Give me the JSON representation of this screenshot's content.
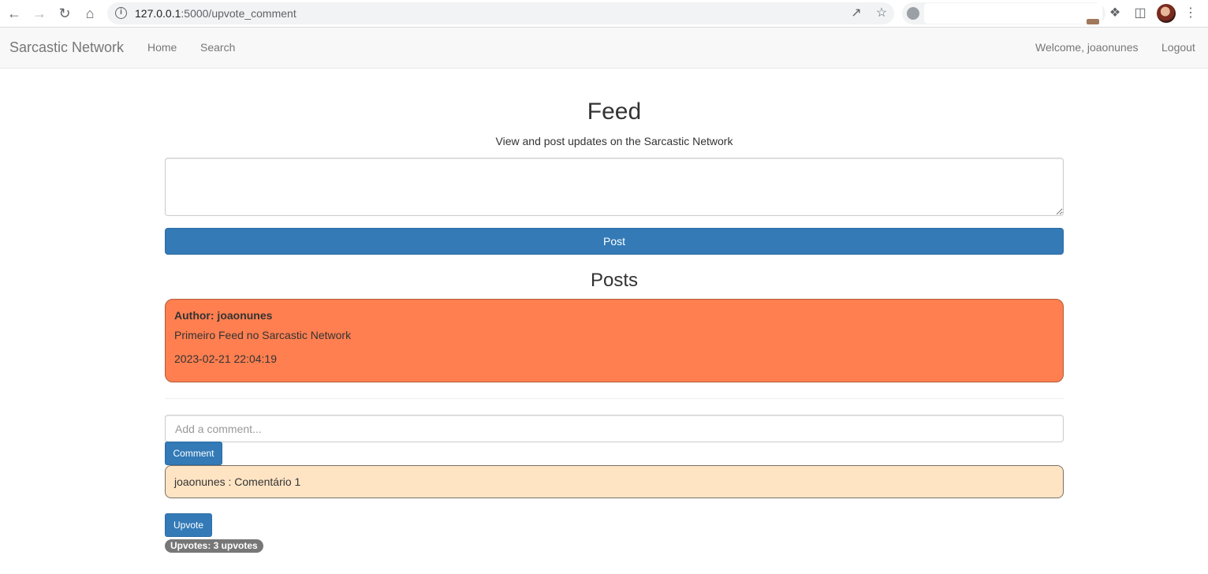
{
  "browser": {
    "url_host": "127.0.0.1",
    "url_path": ":5000/upvote_comment",
    "icons": [
      "back-icon",
      "forward-icon",
      "reload-icon",
      "home-icon",
      "info-icon",
      "share-icon",
      "star-icon",
      "extensions-icon",
      "side-panel-icon",
      "menu-icon"
    ]
  },
  "navbar": {
    "brand": "Sarcastic Network",
    "links": [
      "Home",
      "Search"
    ],
    "welcome": "Welcome, joaonunes",
    "logout": "Logout",
    "background": "#f8f8f8"
  },
  "feed": {
    "title": "Feed",
    "subtitle": "View and post updates on the Sarcastic Network",
    "textarea_value": "",
    "post_button": "Post"
  },
  "posts": {
    "title": "Posts",
    "items": [
      {
        "author": "Author: joaonunes",
        "content": "Primeiro Feed no Sarcastic Network",
        "date": "2023-02-21 22:04:19",
        "color": "#ff7f50"
      }
    ]
  },
  "comments": {
    "placeholder": "Add a comment...",
    "button": "Comment",
    "items": [
      {
        "text": "joaonunes : Comentário 1",
        "color": "#ffe4c4"
      }
    ],
    "upvote_button": "Upvote",
    "upvotes_badge": "Upvotes: 3 upvotes"
  },
  "colors": {
    "primary": "#337ab7",
    "badge": "#777777"
  }
}
